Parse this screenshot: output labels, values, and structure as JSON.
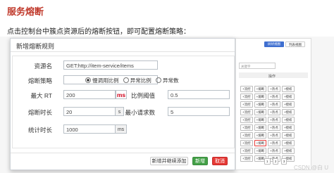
{
  "page": {
    "title": "服务熔断",
    "instruction": "点击控制台中簇点资源后的熔断按钮，即可配置熔断策略："
  },
  "dialog": {
    "title": "新增熔断规则",
    "resource": {
      "label": "资源名",
      "value": "GET:http://item-service/items"
    },
    "strategy": {
      "label": "熔断策略",
      "options": [
        "慢调用比例",
        "异常比例",
        "异常数"
      ],
      "selected": "慢调用比例"
    },
    "max_rt": {
      "label": "最大 RT",
      "value": "200",
      "unit": "ms"
    },
    "ratio": {
      "label": "比例阈值",
      "value": "0.5"
    },
    "duration": {
      "label": "熔断时长",
      "value": "20",
      "unit": "s"
    },
    "min_requests": {
      "label": "最小请求数",
      "value": "5"
    },
    "stat_duration": {
      "label": "统计时长",
      "value": "1000",
      "unit": "ms"
    },
    "buttons": {
      "continue": "新增并继续添加",
      "add": "新增",
      "cancel": "取消"
    }
  },
  "right_panel": {
    "tab_tree": "树状视图",
    "tab_list": "列表视图",
    "search_placeholder": "关键字",
    "ops_header": "操作",
    "chips": [
      "+流控",
      "+熔断",
      "+热点",
      "+授权"
    ],
    "rows": 10,
    "highlight_row": 7,
    "pagination": [
      "1",
      "2",
      "3"
    ]
  },
  "watermark": "CSDN @白 U"
}
